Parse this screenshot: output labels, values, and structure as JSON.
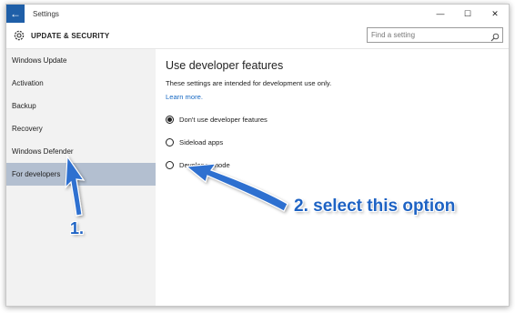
{
  "window": {
    "title": "Settings",
    "controls": {
      "minimize": "—",
      "maximize": "☐",
      "close": "✕"
    }
  },
  "header": {
    "section": "UPDATE & SECURITY",
    "search_placeholder": "Find a setting"
  },
  "sidebar": {
    "items": [
      {
        "label": "Windows Update"
      },
      {
        "label": "Activation"
      },
      {
        "label": "Backup"
      },
      {
        "label": "Recovery"
      },
      {
        "label": "Windows Defender"
      },
      {
        "label": "For developers",
        "active": true
      }
    ]
  },
  "main": {
    "heading": "Use developer features",
    "description": "These settings are intended for development use only.",
    "learn_more": "Learn more.",
    "options": [
      {
        "label": "Don't use developer features",
        "selected": true
      },
      {
        "label": "Sideload apps",
        "selected": false
      },
      {
        "label": "Developer mode",
        "selected": false
      }
    ]
  },
  "annotations": {
    "step1": "1.",
    "step2": "2. select this option",
    "color": "#1e63c4"
  }
}
